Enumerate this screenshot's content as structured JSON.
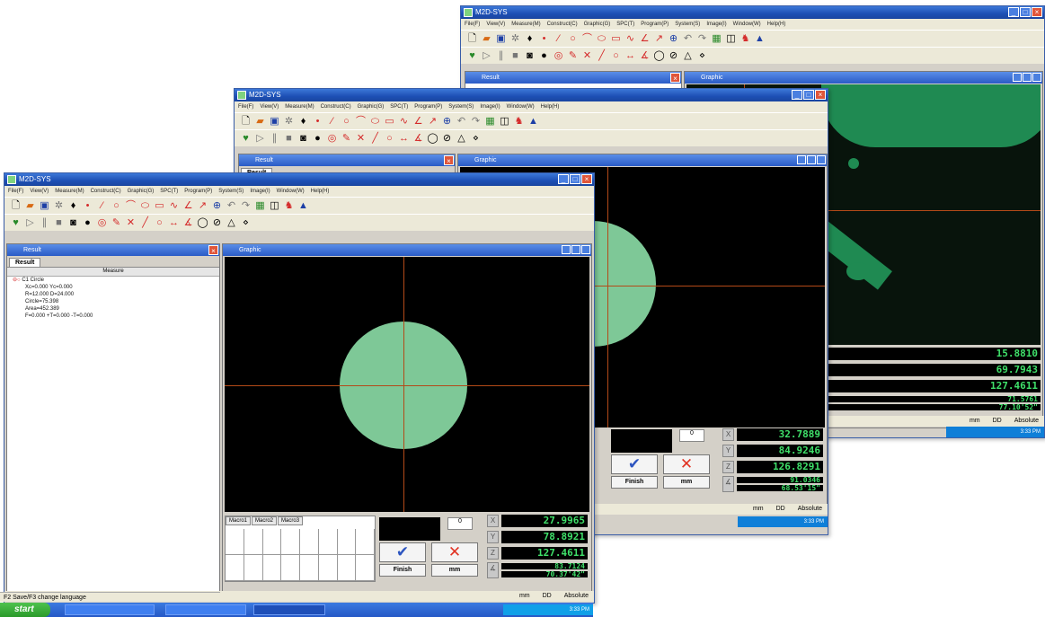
{
  "menu": [
    "File(F)",
    "View(V)",
    "Measure(M)",
    "Construct(C)",
    "Graphic(G)",
    "SPC(T)",
    "Program(P)",
    "System(S)",
    "Image(I)",
    "Window(W)",
    "Help(H)"
  ],
  "window_title": "M2D-SYS",
  "result_panel": {
    "title": "Result",
    "tab": "Result",
    "header": "Measure",
    "tree_root": "C1    Circle",
    "lines": [
      "Xc=0.000    Yc=0.000",
      "R=12.000    D=24.000",
      "Circle=75.398",
      "Area=452.389",
      "F=0.000    +T=0.000    -T=0.000"
    ]
  },
  "graphic_title": "Graphic",
  "grid_tabs": [
    "Macro1",
    "Macro2",
    "Macro3"
  ],
  "spinner_value": "0",
  "buttons": {
    "finish": "Finish",
    "mm": "mm"
  },
  "coords_front": {
    "x": "27.9965",
    "y": "78.8921",
    "z": "127.4611",
    "a1": "83.7124",
    "a2": "70.37'42\""
  },
  "coords_mid": {
    "x": "32.7889",
    "y": "84.9246",
    "z": "126.8291",
    "a1": "91.0346",
    "a2": "68.53'15\""
  },
  "coords_back": {
    "x": "15.8810",
    "y": "69.7943",
    "z": "127.4611",
    "a1": "71.5761",
    "a2": "77.10'52\""
  },
  "status": {
    "unit": "mm",
    "format": "DD",
    "mode": "Absolute",
    "left_hint": "F2 Save/F3 change language"
  },
  "taskbar": {
    "start": "start",
    "tray_time": "3:33 PM"
  },
  "axis_labels": {
    "x": "X",
    "y": "Y",
    "z": "Z"
  }
}
